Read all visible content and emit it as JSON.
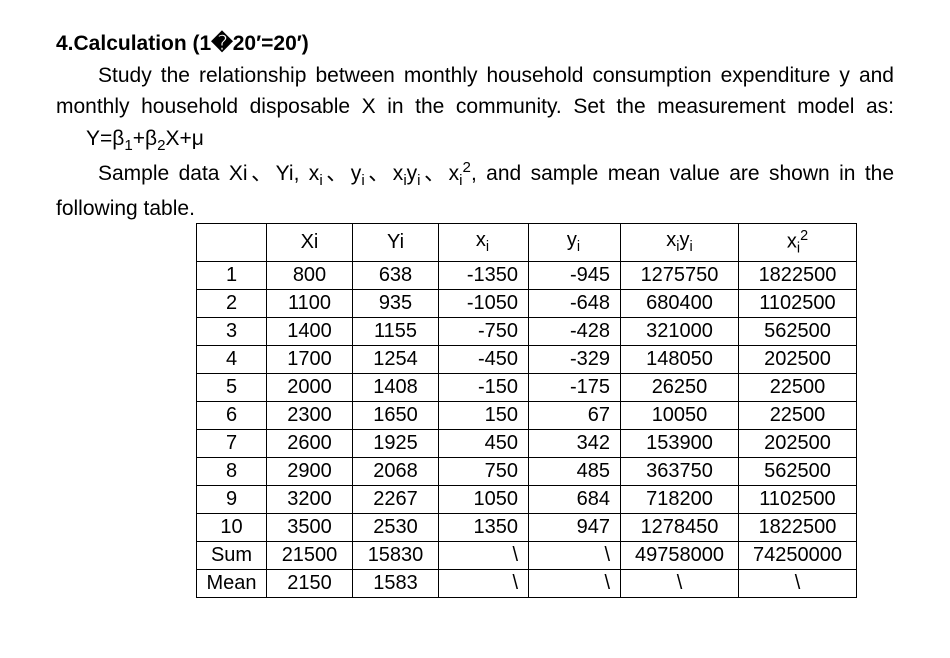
{
  "heading": "4.Calculation (1�20′=20′)",
  "para1_part1": "Study the relationship between monthly household consumption expenditure y and monthly household disposable X in the community. Set the measurement model as:",
  "equation": "Y=β₁+β₂X+μ",
  "para2_part1": "Sample data Xi、Yi, xᵢ、yᵢ、xᵢyᵢ、xᵢ², and sample mean value are shown in the following table.",
  "headers": {
    "blank": "",
    "Xi": "Xi",
    "Yi": "Yi",
    "xd": "xᵢ",
    "yd": "yᵢ",
    "xy": "xᵢyᵢ",
    "x2": "xᵢ²"
  },
  "rows": [
    {
      "idx": "1",
      "Xi": "800",
      "Yi": "638",
      "xd": "-1350",
      "yd": "-945",
      "xy": "1275750",
      "x2": "1822500"
    },
    {
      "idx": "2",
      "Xi": "1100",
      "Yi": "935",
      "xd": "-1050",
      "yd": "-648",
      "xy": "680400",
      "x2": "1102500"
    },
    {
      "idx": "3",
      "Xi": "1400",
      "Yi": "1155",
      "xd": "-750",
      "yd": "-428",
      "xy": "321000",
      "x2": "562500"
    },
    {
      "idx": "4",
      "Xi": "1700",
      "Yi": "1254",
      "xd": "-450",
      "yd": "-329",
      "xy": "148050",
      "x2": "202500"
    },
    {
      "idx": "5",
      "Xi": "2000",
      "Yi": "1408",
      "xd": "-150",
      "yd": "-175",
      "xy": "26250",
      "x2": "22500"
    },
    {
      "idx": "6",
      "Xi": "2300",
      "Yi": "1650",
      "xd": "150",
      "yd": "67",
      "xy": "10050",
      "x2": "22500"
    },
    {
      "idx": "7",
      "Xi": "2600",
      "Yi": "1925",
      "xd": "450",
      "yd": "342",
      "xy": "153900",
      "x2": "202500"
    },
    {
      "idx": "8",
      "Xi": "2900",
      "Yi": "2068",
      "xd": "750",
      "yd": "485",
      "xy": "363750",
      "x2": "562500"
    },
    {
      "idx": "9",
      "Xi": "3200",
      "Yi": "2267",
      "xd": "1050",
      "yd": "684",
      "xy": "718200",
      "x2": "1102500"
    },
    {
      "idx": "10",
      "Xi": "3500",
      "Yi": "2530",
      "xd": "1350",
      "yd": "947",
      "xy": "1278450",
      "x2": "1822500"
    }
  ],
  "sum": {
    "idx": "Sum",
    "Xi": "21500",
    "Yi": "15830",
    "xd": "\\",
    "yd": "\\",
    "xy": "49758000",
    "x2": "74250000"
  },
  "mean": {
    "idx": "Mean",
    "Xi": "2150",
    "Yi": "1583",
    "xd": "\\",
    "yd": "\\",
    "xy": "\\",
    "x2": "\\"
  }
}
